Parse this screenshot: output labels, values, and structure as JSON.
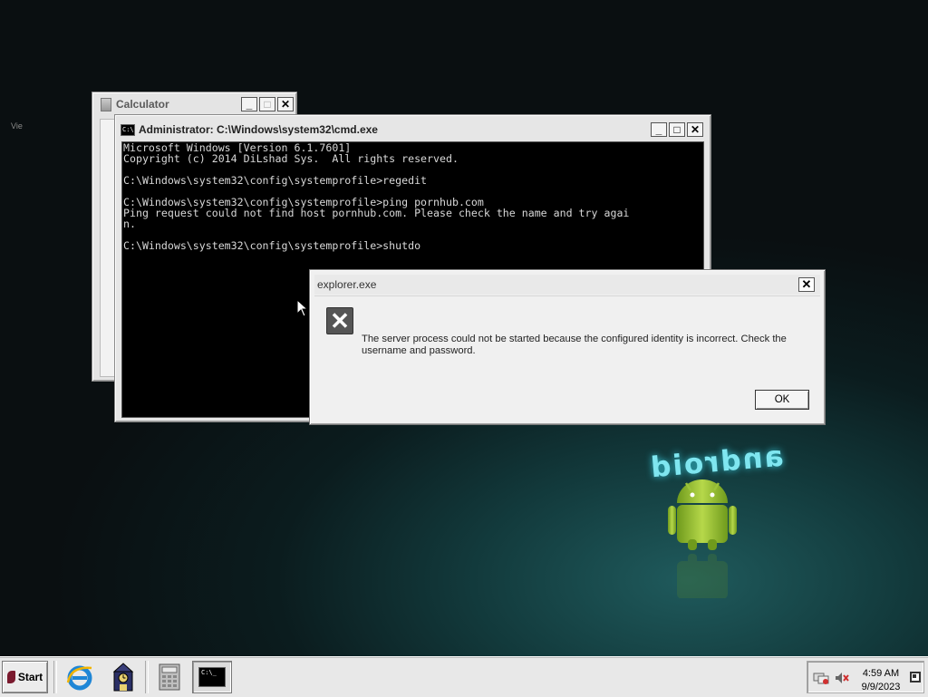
{
  "desktop": {
    "android_logo_text": "android"
  },
  "calculator": {
    "title": "Calculator",
    "menu_fragment": "Vie"
  },
  "cmd": {
    "title": "Administrator: C:\\Windows\\system32\\cmd.exe",
    "icon_text": "C:\\",
    "lines": [
      "Microsoft Windows [Version 6.1.7601]",
      "Copyright (c) 2014 DiLshad Sys.  All rights reserved.",
      "",
      "C:\\Windows\\system32\\config\\systemprofile>regedit",
      "",
      "C:\\Windows\\system32\\config\\systemprofile>ping pornhub.com",
      "Ping request could not find host pornhub.com. Please check the name and try agai",
      "n.",
      "",
      "C:\\Windows\\system32\\config\\systemprofile>shutdo"
    ]
  },
  "dialog": {
    "title": "explorer.exe",
    "message": "The server process could not be started because the configured identity is incorrect. Check the username and password.",
    "ok_label": "OK"
  },
  "window_controls": {
    "minimize": "_",
    "maximize": "□",
    "close": "✕"
  },
  "taskbar": {
    "start_label": "Start",
    "quicklaunch": [
      "internet-explorer-icon",
      "clock-tower-icon"
    ],
    "tasks": [
      "calculator-icon",
      "cmd-icon"
    ],
    "cmd_task_text": "C:\\_",
    "tray_icons": [
      "network-icon",
      "volume-muted-icon"
    ],
    "clock_time": "4:59 AM",
    "clock_date": "9/9/2023"
  }
}
